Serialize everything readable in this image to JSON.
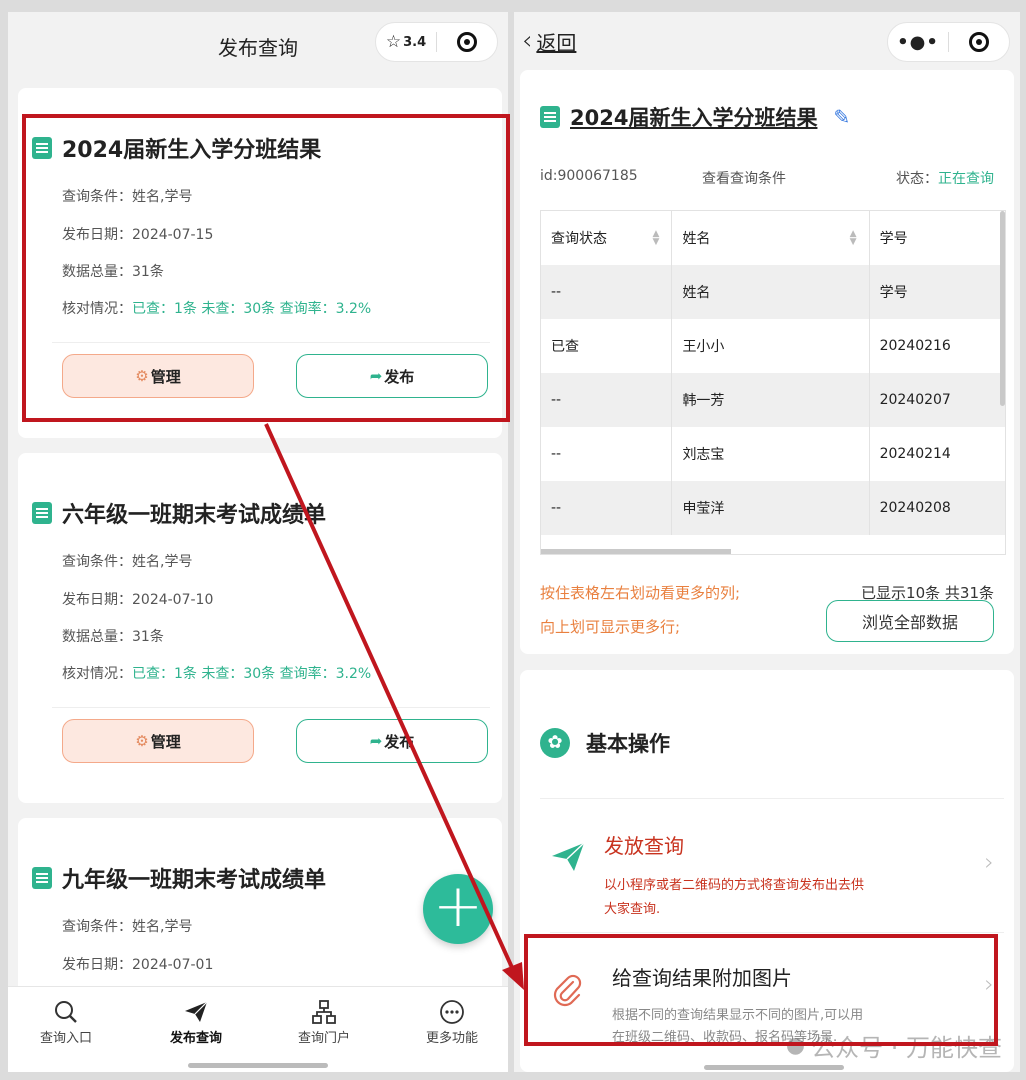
{
  "left": {
    "header": {
      "title": "发布查询",
      "rating": "3.4"
    },
    "cards": [
      {
        "title": "2024届新生入学分班结果",
        "cond_label": "查询条件：",
        "cond_value": "姓名,学号",
        "date_label": "发布日期：",
        "date_value": "2024-07-15",
        "total_label": "数据总量：",
        "total_value": "31条",
        "check_label": "核对情况：",
        "check_value": "已查：1条 未查：30条 查询率：3.2%",
        "manage": "管理",
        "publish": "发布"
      },
      {
        "title": "六年级一班期末考试成绩单",
        "cond_label": "查询条件：",
        "cond_value": "姓名,学号",
        "date_label": "发布日期：",
        "date_value": "2024-07-10",
        "total_label": "数据总量：",
        "total_value": "31条",
        "check_label": "核对情况：",
        "check_value": "已查：1条 未查：30条 查询率：3.2%",
        "manage": "管理",
        "publish": "发布"
      },
      {
        "title": "九年级一班期末考试成绩单",
        "cond_label": "查询条件：",
        "cond_value": "姓名,学号",
        "date_label": "发布日期：",
        "date_value": "2024-07-01"
      }
    ],
    "tabs": [
      {
        "label": "查询入口",
        "icon": "search-icon"
      },
      {
        "label": "发布查询",
        "icon": "paper-plane-icon"
      },
      {
        "label": "查询门户",
        "icon": "sitemap-icon"
      },
      {
        "label": "更多功能",
        "icon": "more-icon"
      }
    ]
  },
  "right": {
    "header": {
      "back": "返回"
    },
    "title": "2024届新生入学分班结果",
    "id_text": "id:900067185",
    "view_conditions": "查看查询条件",
    "status_label": "状态：",
    "status_value": "正在查询",
    "table": {
      "headers": [
        "查询状态",
        "姓名",
        "学号"
      ],
      "rows": [
        [
          "--",
          "姓名",
          "学号"
        ],
        [
          "已查",
          "王小小",
          "20240216"
        ],
        [
          "--",
          "韩一芳",
          "20240207"
        ],
        [
          "--",
          "刘志宝",
          "20240214"
        ],
        [
          "--",
          "申莹洋",
          "20240208"
        ]
      ]
    },
    "hint1": "按住表格左右划动看更多的列;",
    "hint2": "向上划可显示更多行;",
    "count_text": "已显示10条 共31条",
    "browse_all": "浏览全部数据",
    "section_title": "基本操作",
    "actions": [
      {
        "title": "发放查询",
        "desc1": "以小程序或者二维码的方式将查询发布出去供",
        "desc2": "大家查询."
      },
      {
        "title": "给查询结果附加图片",
        "desc1": "根据不同的查询结果显示不同的图片,可以用",
        "desc2": "在班级二维码、收款码、报名码等场景."
      }
    ],
    "watermark": "公众号 · 万能快查"
  },
  "colors": {
    "accent": "#2fb38e",
    "highlight": "#c0161e",
    "orange": "#e9803f",
    "red": "#c8321e"
  }
}
